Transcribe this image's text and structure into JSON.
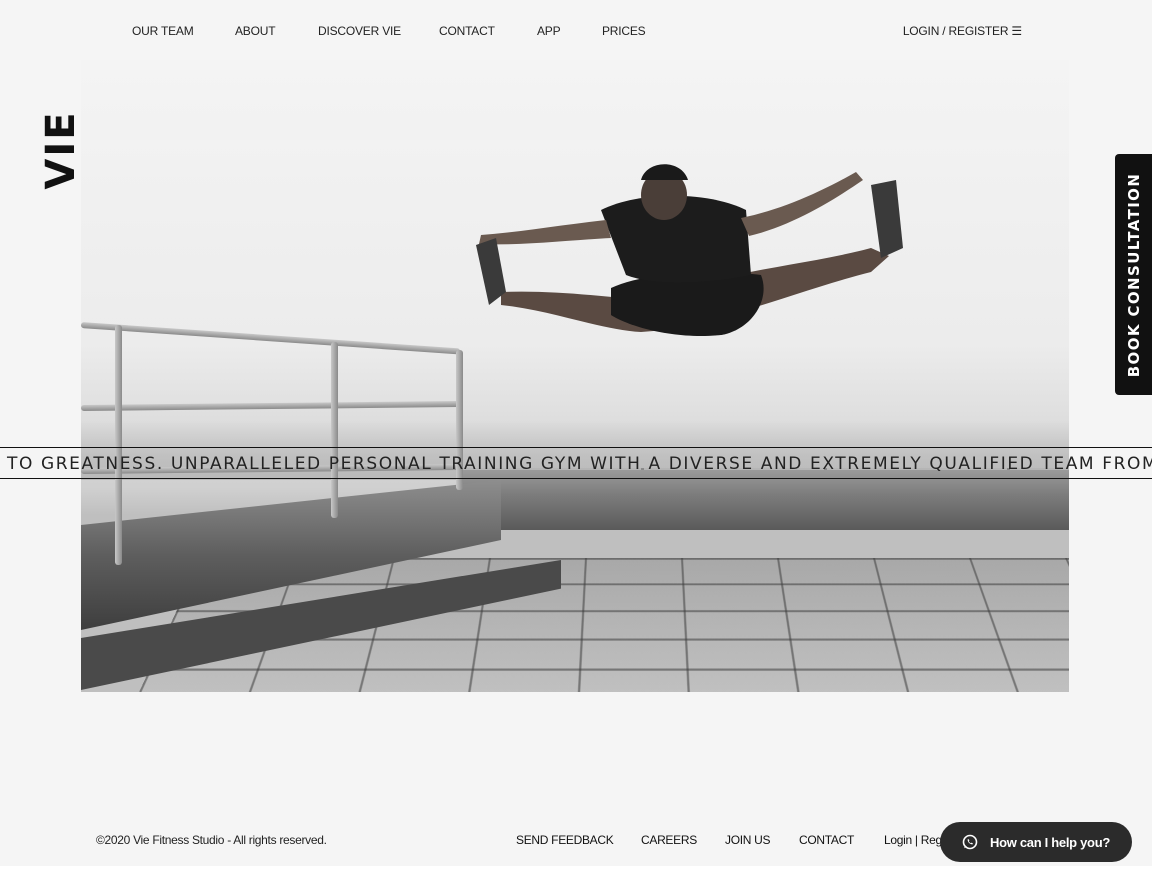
{
  "nav": {
    "items": [
      {
        "label": "OUR TEAM"
      },
      {
        "label": "ABOUT"
      },
      {
        "label": "DISCOVER VIE"
      },
      {
        "label": "CONTACT"
      },
      {
        "label": "APP"
      },
      {
        "label": "PRICES"
      }
    ],
    "login": "LOGIN / REGISTER ☰"
  },
  "logo": {
    "text": "VIE"
  },
  "marquee": {
    "text": "TO GREATNESS. UNPARALLELED PERSONAL TRAINING GYM WITH A DIVERSE AND EXTREMELY QUALIFIED TEAM FROM AL"
  },
  "book_tab": {
    "label": "BOOK CONSULTATION"
  },
  "footer": {
    "copyright": "©2020 Vie Fitness Studio - All rights reserved.",
    "links": [
      {
        "label": "SEND FEEDBACK"
      },
      {
        "label": "CAREERS"
      },
      {
        "label": "JOIN US"
      },
      {
        "label": "CONTACT"
      },
      {
        "label": "Login | Reg"
      }
    ]
  },
  "chat": {
    "label": "How can I help you?",
    "icon": "whatsapp-icon"
  }
}
